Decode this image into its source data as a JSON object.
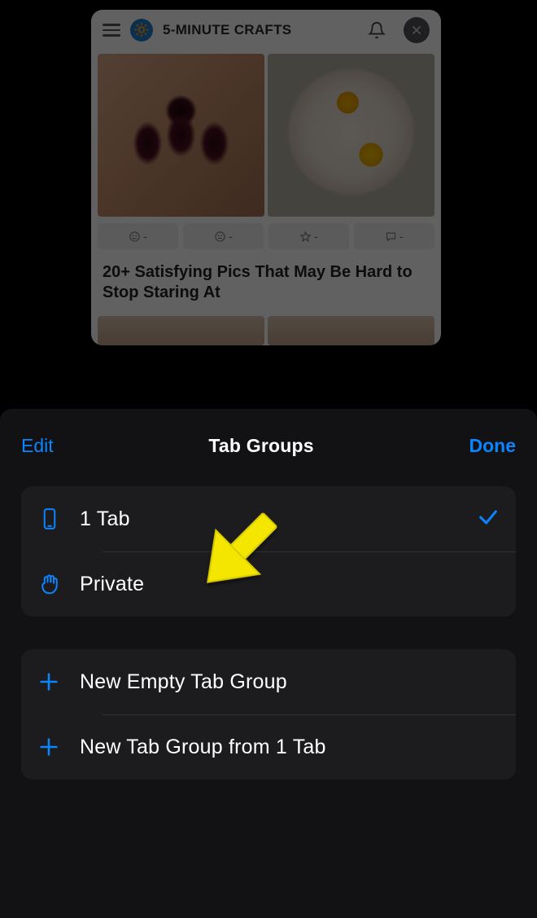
{
  "background_tab": {
    "brand": "5-MINUTE CRAFTS",
    "brand_emoji": "🔆",
    "article_title": "20+ Satisfying Pics That May Be Hard to Stop Staring At",
    "reaction_labels": {
      "happy": "-",
      "sad": "-",
      "star": "-",
      "comment": "-"
    }
  },
  "sheet": {
    "title": "Tab Groups",
    "edit_label": "Edit",
    "done_label": "Done",
    "section1": [
      {
        "label": "1 Tab",
        "selected": true
      },
      {
        "label": "Private",
        "selected": false
      }
    ],
    "section2": [
      {
        "label": "New Empty Tab Group"
      },
      {
        "label": "New Tab Group from 1 Tab"
      }
    ]
  }
}
